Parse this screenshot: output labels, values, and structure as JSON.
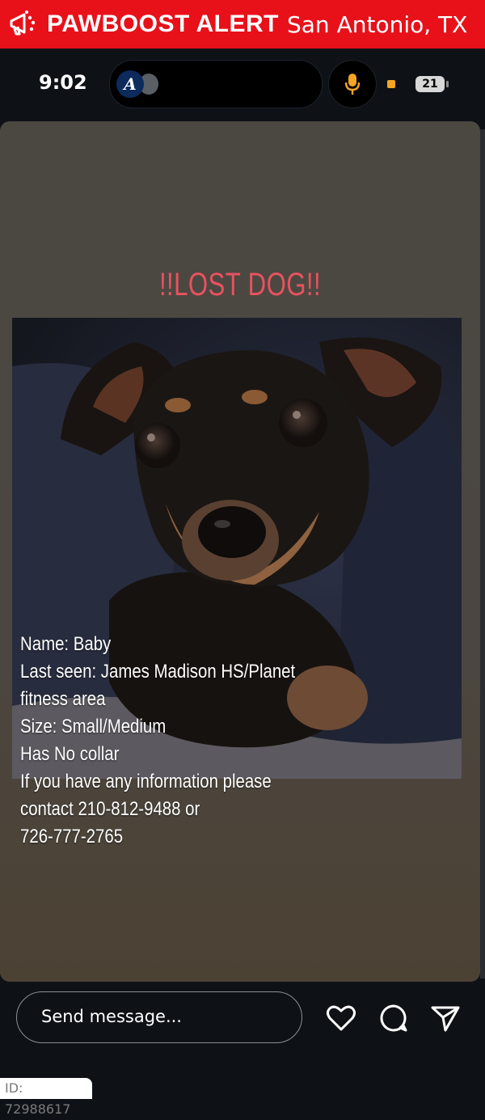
{
  "alert": {
    "brand": "PAWBOOST ALERT",
    "location": "San Antonio, TX",
    "icon": "megaphone-paw-icon"
  },
  "status": {
    "time": "9:02",
    "app_badge": "A",
    "battery": "21",
    "icons": [
      "braves-logo-icon",
      "microphone-icon",
      "recording-dot-icon",
      "battery-icon"
    ]
  },
  "story": {
    "title": "!!LOST DOG!!",
    "info_lines": [
      "Name: Baby",
      "Last seen: James Madison HS/Planet",
      "fitness area",
      "Size: Small/Medium",
      "Has No collar",
      "If you have any information please",
      "contact 210-812-9488 or",
      "726-777-2765"
    ]
  },
  "composer": {
    "placeholder": "Send message...",
    "icons": [
      "heart-icon",
      "comment-icon",
      "send-icon"
    ]
  },
  "footer": {
    "id_label": "ID: 72988617"
  },
  "colors": {
    "alert_red": "#e8111a",
    "title_pink": "#e8525e",
    "background": "#0e1217"
  }
}
